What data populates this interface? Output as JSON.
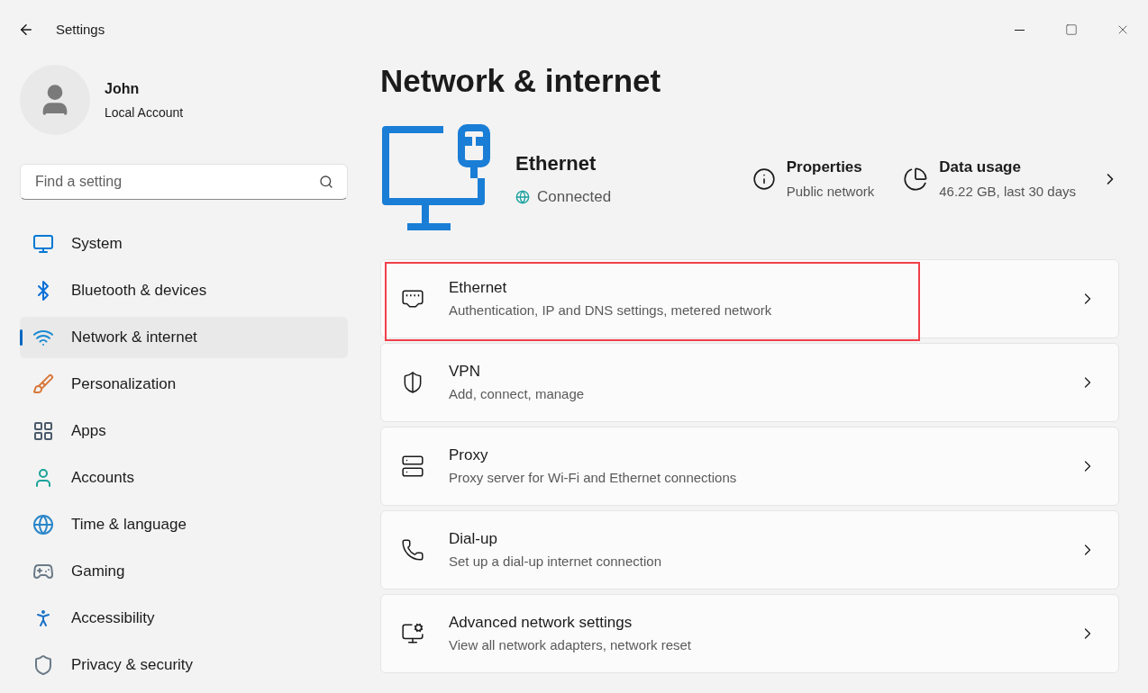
{
  "window": {
    "title": "Settings"
  },
  "account": {
    "name": "John",
    "type": "Local Account"
  },
  "search": {
    "placeholder": "Find a setting"
  },
  "sidebar": {
    "items": [
      {
        "label": "System",
        "selected": false
      },
      {
        "label": "Bluetooth & devices",
        "selected": false
      },
      {
        "label": "Network & internet",
        "selected": true
      },
      {
        "label": "Personalization",
        "selected": false
      },
      {
        "label": "Apps",
        "selected": false
      },
      {
        "label": "Accounts",
        "selected": false
      },
      {
        "label": "Time & language",
        "selected": false
      },
      {
        "label": "Gaming",
        "selected": false
      },
      {
        "label": "Accessibility",
        "selected": false
      },
      {
        "label": "Privacy & security",
        "selected": false
      }
    ]
  },
  "page": {
    "title": "Network & internet"
  },
  "connection": {
    "name": "Ethernet",
    "status": "Connected",
    "properties": {
      "title": "Properties",
      "value": "Public network"
    },
    "data_usage": {
      "title": "Data usage",
      "value": "46.22 GB, last 30 days"
    }
  },
  "rows": [
    {
      "title": "Ethernet",
      "subtitle": "Authentication, IP and DNS settings, metered network",
      "highlighted": true
    },
    {
      "title": "VPN",
      "subtitle": "Add, connect, manage",
      "highlighted": false
    },
    {
      "title": "Proxy",
      "subtitle": "Proxy server for Wi-Fi and Ethernet connections",
      "highlighted": false
    },
    {
      "title": "Dial-up",
      "subtitle": "Set up a dial-up internet connection",
      "highlighted": false
    },
    {
      "title": "Advanced network settings",
      "subtitle": "View all network adapters, network reset",
      "highlighted": false
    }
  ]
}
